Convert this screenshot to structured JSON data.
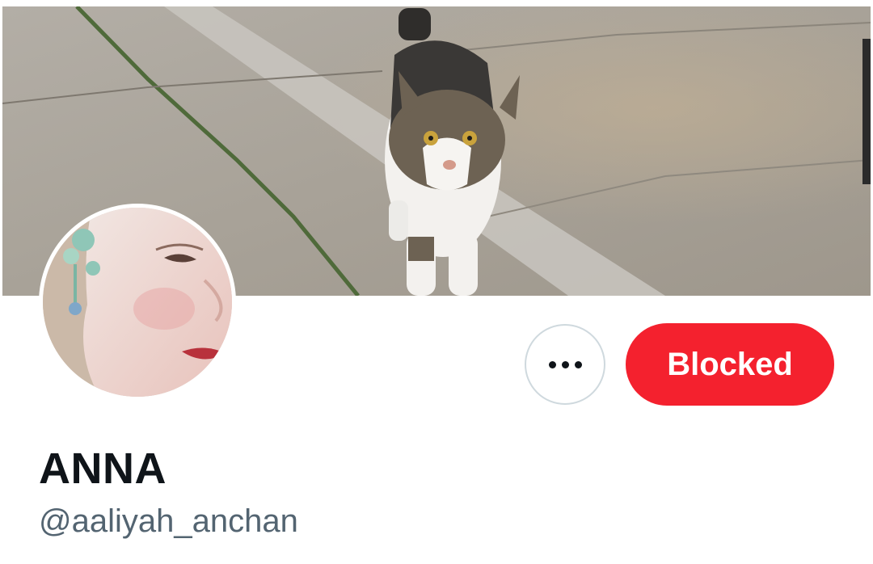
{
  "profile": {
    "display_name": "ANNA",
    "handle": "@aaliyah_anchan",
    "banner_image": "cat-on-pavement-banner",
    "avatar_image": "profile-avatar-photo"
  },
  "actions": {
    "more_icon": "more-horizontal-icon",
    "blocked_label": "Blocked"
  },
  "colors": {
    "blocked_bg": "#f4212e",
    "name_text": "#0f1419",
    "handle_text": "#536471",
    "border": "#cfd9de"
  }
}
